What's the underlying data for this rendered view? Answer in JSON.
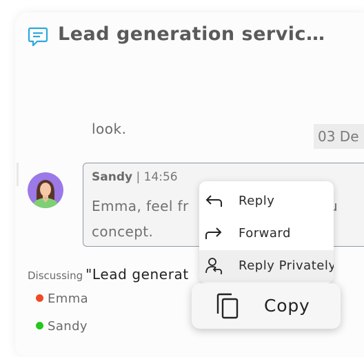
{
  "chat": {
    "title": "Lead generation servic…",
    "title_icon": "chat-bubble-icon"
  },
  "previous_message": {
    "text": "look.",
    "date": "03 De"
  },
  "message": {
    "author": "Sandy",
    "separator": " | ",
    "time": "14:56",
    "body": "Emma, feel fr",
    "body_partial_right": "cu",
    "body_line2": "concept."
  },
  "discussion": {
    "label": "Discussing",
    "subject": "\"Lead generat",
    "participants": [
      {
        "name": "Emma",
        "status_color": "#f04a24"
      },
      {
        "name": "Sandy",
        "status_color": "#22c91c"
      }
    ]
  },
  "context_menu": {
    "items": [
      {
        "label": "Reply",
        "icon": "reply-arrow-icon"
      },
      {
        "label": "Forward",
        "icon": "forward-arrow-icon"
      },
      {
        "label": "Reply Privately",
        "icon": "reply-privately-icon"
      }
    ],
    "copy": {
      "label": "Copy",
      "icon": "copy-icon"
    }
  },
  "colors": {
    "accent": "#29a8e0",
    "bubble_border": "#8a9aa8",
    "avatar_bg": "#9b79e6"
  }
}
